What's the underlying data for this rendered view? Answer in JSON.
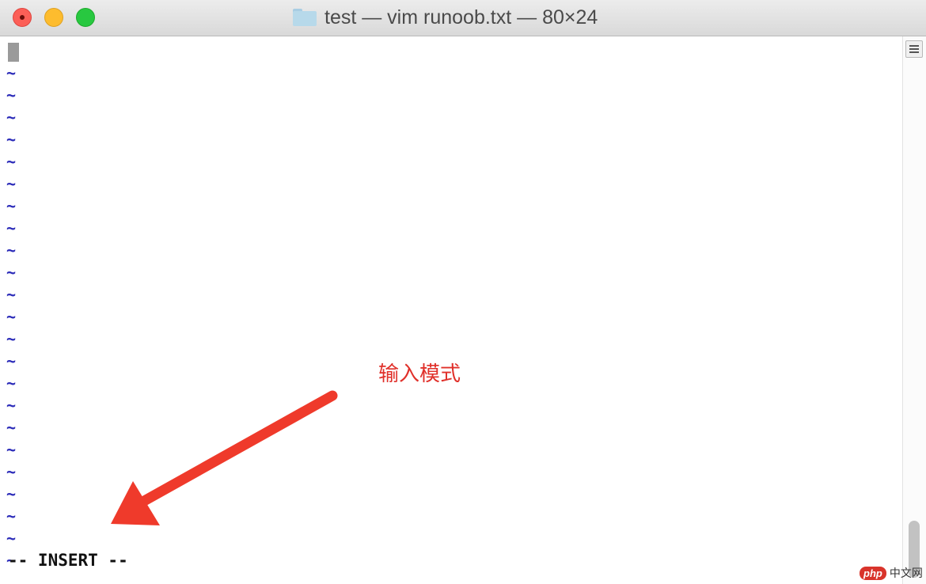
{
  "window": {
    "title": "test — vim runoob.txt — 80×24",
    "folder_icon": "folder-icon",
    "traffic_lights": {
      "close": "#fc5f57",
      "minimize": "#fdbc2e",
      "maximize": "#28c840"
    }
  },
  "editor": {
    "empty_line_marker": "~",
    "empty_line_count": 23,
    "tilde_color": "#2a2ab8",
    "status_line": "-- INSERT --"
  },
  "annotation": {
    "text": "输入模式",
    "color": "#e0302a",
    "arrow_icon": "red-arrow-icon"
  },
  "watermark": {
    "logo": "php",
    "text": "中文网"
  }
}
